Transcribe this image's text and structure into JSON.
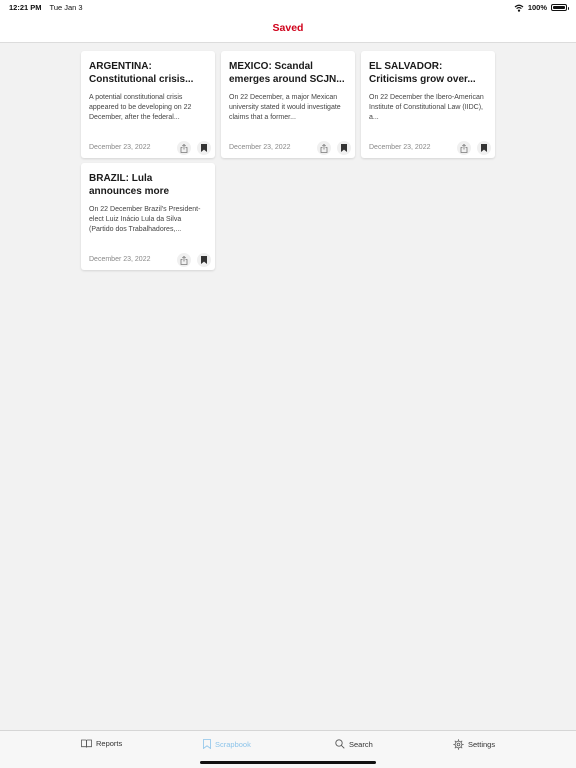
{
  "status": {
    "time": "12:21 PM",
    "date": "Tue Jan 3",
    "battery_text": "100%",
    "battery_level": 1.0
  },
  "nav": {
    "title": "Saved"
  },
  "colors": {
    "accent": "#d0021b",
    "active_tab": "#8cc4ea"
  },
  "cards": [
    {
      "title": "ARGENTINA: Constitutional crisis...",
      "summary": "A potential constitutional crisis appeared to be developing on 22 December, after the federal...",
      "date": "December 23, 2022"
    },
    {
      "title": "MEXICO: Scandal emerges around SCJN...",
      "summary": "On 22 December, a major Mexican university stated it would investigate claims that a former...",
      "date": "December 23, 2022"
    },
    {
      "title": "EL SALVADOR: Criticisms grow over...",
      "summary": "On 22 December the Ibero-American Institute of Constitutional Law (IIDC), a...",
      "date": "December 23, 2022"
    },
    {
      "title": "BRAZIL: Lula announces more ministerial picks",
      "summary": "On 22 December Brazil's President-elect Luiz Inácio Lula da Silva (Partido dos Trabalhadores,...",
      "date": "December 23, 2022"
    }
  ],
  "tabs": [
    {
      "label": "Reports",
      "icon": "book-icon"
    },
    {
      "label": "Scrapbook",
      "icon": "bookmark-icon",
      "active": true
    },
    {
      "label": "Search",
      "icon": "search-icon"
    },
    {
      "label": "Settings",
      "icon": "gear-icon"
    }
  ]
}
